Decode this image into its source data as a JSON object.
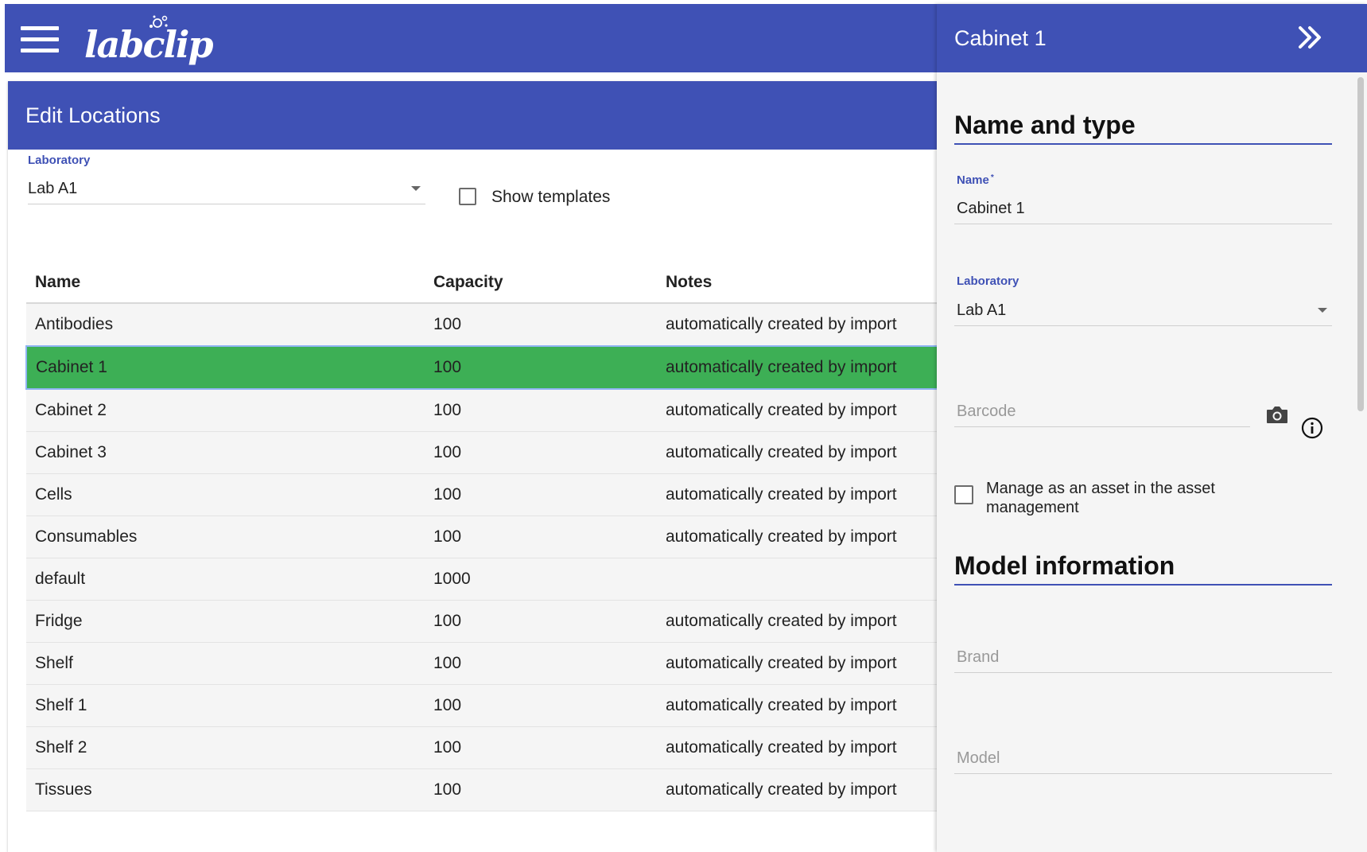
{
  "app": {
    "logo_text": "labclip"
  },
  "page": {
    "title": "Edit Locations",
    "laboratory_label": "Laboratory",
    "laboratory_value": "Lab A1",
    "show_templates_label": "Show templates"
  },
  "table": {
    "headers": [
      "Name",
      "Capacity",
      "Notes"
    ],
    "rows": [
      {
        "name": "Antibodies",
        "capacity": "100",
        "notes": "automatically created by import"
      },
      {
        "name": "Cabinet 1",
        "capacity": "100",
        "notes": "automatically created by import"
      },
      {
        "name": "Cabinet 2",
        "capacity": "100",
        "notes": "automatically created by import"
      },
      {
        "name": "Cabinet 3",
        "capacity": "100",
        "notes": "automatically created by import"
      },
      {
        "name": "Cells",
        "capacity": "100",
        "notes": "automatically created by import"
      },
      {
        "name": "Consumables",
        "capacity": "100",
        "notes": "automatically created by import"
      },
      {
        "name": "default",
        "capacity": "1000",
        "notes": ""
      },
      {
        "name": "Fridge",
        "capacity": "100",
        "notes": "automatically created by import"
      },
      {
        "name": "Shelf",
        "capacity": "100",
        "notes": "automatically created by import"
      },
      {
        "name": "Shelf 1",
        "capacity": "100",
        "notes": "automatically created by import"
      },
      {
        "name": "Shelf 2",
        "capacity": "100",
        "notes": "automatically created by import"
      },
      {
        "name": "Tissues",
        "capacity": "100",
        "notes": "automatically created by import"
      }
    ]
  },
  "panel": {
    "title": "Cabinet 1",
    "section_name_type": "Name and type",
    "name_label": "Name",
    "name_required_mark": "*",
    "name_value": "Cabinet 1",
    "laboratory_label": "Laboratory",
    "laboratory_value": "Lab A1",
    "barcode_placeholder": "Barcode",
    "asset_label": "Manage as an asset in the asset management",
    "section_model": "Model information",
    "brand_placeholder": "Brand",
    "model_placeholder": "Model"
  },
  "colors": {
    "primary": "#3f51b5",
    "selected_row": "#3daf55"
  }
}
